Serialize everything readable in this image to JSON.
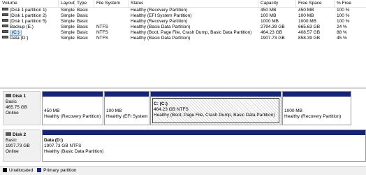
{
  "columns": [
    "Volume",
    "Layout",
    "Type",
    "File System",
    "Status",
    "Capacity",
    "Free Space",
    "% Free"
  ],
  "volumes": [
    {
      "volume": "(Disk 1 partition 1)",
      "layout": "Simple",
      "type": "Basic",
      "fs": "",
      "status": "Healthy (Recovery Partition)",
      "capacity": "450 MB",
      "free": "450 MB",
      "pct": "100 %"
    },
    {
      "volume": "(Disk 1 partition 2)",
      "layout": "Simple",
      "type": "Basic",
      "fs": "",
      "status": "Healthy (EFI System Partition)",
      "capacity": "100 MB",
      "free": "100 MB",
      "pct": "100 %"
    },
    {
      "volume": "(Disk 1 partition 5)",
      "layout": "Simple",
      "type": "Basic",
      "fs": "",
      "status": "Healthy (Recovery Partition)",
      "capacity": "1000 MB",
      "free": "1000 MB",
      "pct": "100 %"
    },
    {
      "volume": "Backup (E:)",
      "layout": "Simple",
      "type": "Basic",
      "fs": "NTFS",
      "status": "Healthy (Basic Data Partition)",
      "capacity": "2794.39 GB",
      "free": "665.63 GB",
      "pct": "24 %"
    },
    {
      "volume": "(C:)",
      "layout": "Simple",
      "type": "Basic",
      "fs": "NTFS",
      "status": "Healthy (Boot, Page File, Crash Dump, Basic Data Partition)",
      "capacity": "464.23 GB",
      "free": "408.57 GB",
      "pct": "88 %"
    },
    {
      "volume": "Data (D:)",
      "layout": "Simple",
      "type": "Basic",
      "fs": "NTFS",
      "status": "Healthy (Basic Data Partition)",
      "capacity": "1907.73 GB",
      "free": "858.39 GB",
      "pct": "45 %"
    }
  ],
  "disks": [
    {
      "name": "Disk 1",
      "type": "Basic",
      "size": "465.75 GB",
      "state": "Online",
      "partitions": [
        {
          "line1": "",
          "line2": "450 MB",
          "line3": "Healthy (Recovery Partition)"
        },
        {
          "line1": "",
          "line2": "100 MB",
          "line3": "Healthy (EFI System"
        },
        {
          "line1": "C:  (C:)",
          "line2": "464.23 GB NTFS",
          "line3": "Healthy (Boot, Page File, Crash Dump, Basic Data Partition)"
        },
        {
          "line1": "",
          "line2": "1000 MB",
          "line3": "Healthy (Recovery Partition)"
        }
      ]
    },
    {
      "name": "Disk 2",
      "type": "Basic",
      "size": "1907.73 GB",
      "state": "Online",
      "partitions": [
        {
          "line1": "Data  (D:)",
          "line2": "1907.73 GB NTFS",
          "line3": "Healthy (Basic Data Partition)"
        }
      ]
    }
  ],
  "legend": {
    "unallocated": {
      "label": "Unallocated",
      "color": "#000000"
    },
    "primary": {
      "label": "Primary partition",
      "color": "#14237e"
    }
  },
  "icons": {
    "volume": "drive-icon",
    "disk": "disk-icon"
  }
}
